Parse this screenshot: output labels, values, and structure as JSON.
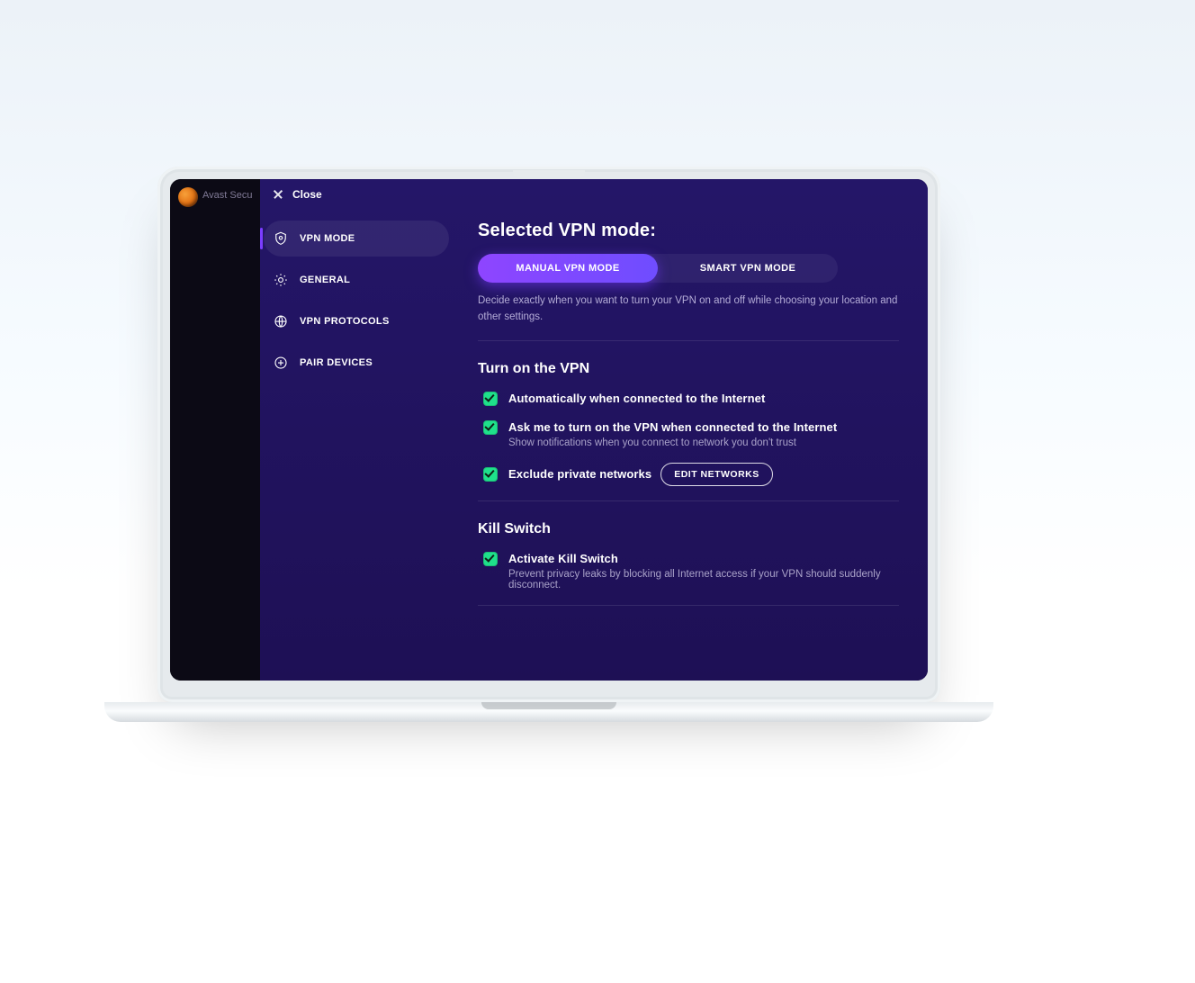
{
  "app": {
    "title": "Avast Secu"
  },
  "header": {
    "close_label": "Close"
  },
  "nav": {
    "items": [
      {
        "label": "VPN MODE"
      },
      {
        "label": "GENERAL"
      },
      {
        "label": "VPN PROTOCOLS"
      },
      {
        "label": "PAIR DEVICES"
      }
    ]
  },
  "content": {
    "title": "Selected VPN mode:",
    "segmented": {
      "manual_label": "MANUAL VPN MODE",
      "smart_label": "SMART VPN MODE"
    },
    "mode_description": "Decide exactly when you want to turn your VPN on and off while choosing your location and other settings.",
    "turn_on": {
      "title": "Turn on the VPN",
      "options": [
        {
          "label": "Automatically when connected to the Internet",
          "sub": ""
        },
        {
          "label": "Ask me to turn on the VPN when connected to the Internet",
          "sub": "Show notifications when you connect to network you don't trust"
        },
        {
          "label": "Exclude private networks",
          "sub": "",
          "action_label": "EDIT NETWORKS"
        }
      ]
    },
    "kill_switch": {
      "title": "Kill Switch",
      "option": {
        "label": "Activate Kill Switch",
        "sub": "Prevent privacy leaks by blocking all Internet access if your VPN should suddenly disconnect."
      }
    }
  },
  "colors": {
    "accent": "#7b3dff",
    "success": "#1fe08b",
    "indigo": "#1f1461"
  }
}
